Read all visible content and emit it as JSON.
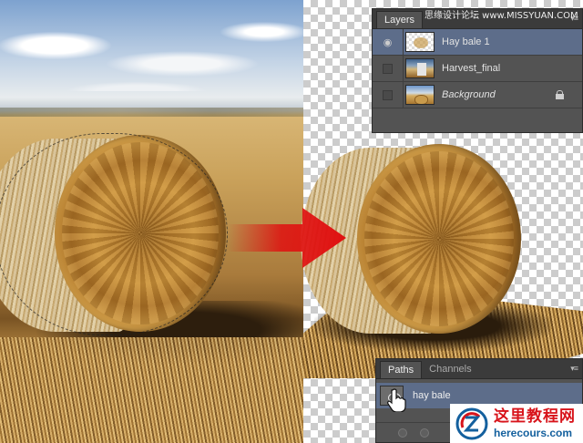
{
  "watermark": "思缘设计论坛 www.MISSYUAN.COM",
  "layers_panel": {
    "tab_label": "Layers",
    "menu_icon": "panel-menu-icon",
    "layers": [
      {
        "name": "Hay bale 1",
        "visible": true,
        "selected": true,
        "thumb": "transparent-bale"
      },
      {
        "name": "Harvest_final",
        "visible": false,
        "selected": false,
        "thumb": "harvest-photo"
      },
      {
        "name": "Background",
        "visible": false,
        "selected": false,
        "thumb": "field-photo",
        "locked": true
      }
    ]
  },
  "paths_panel": {
    "tabs": [
      "Paths",
      "Channels"
    ],
    "active_tab": "Paths",
    "path_name": "hay bale"
  },
  "logo": {
    "title": "这里教程网",
    "url": "herecours.com",
    "accent": "#d8141b",
    "url_color": "#14609e"
  },
  "arrow_color": "#e01010"
}
